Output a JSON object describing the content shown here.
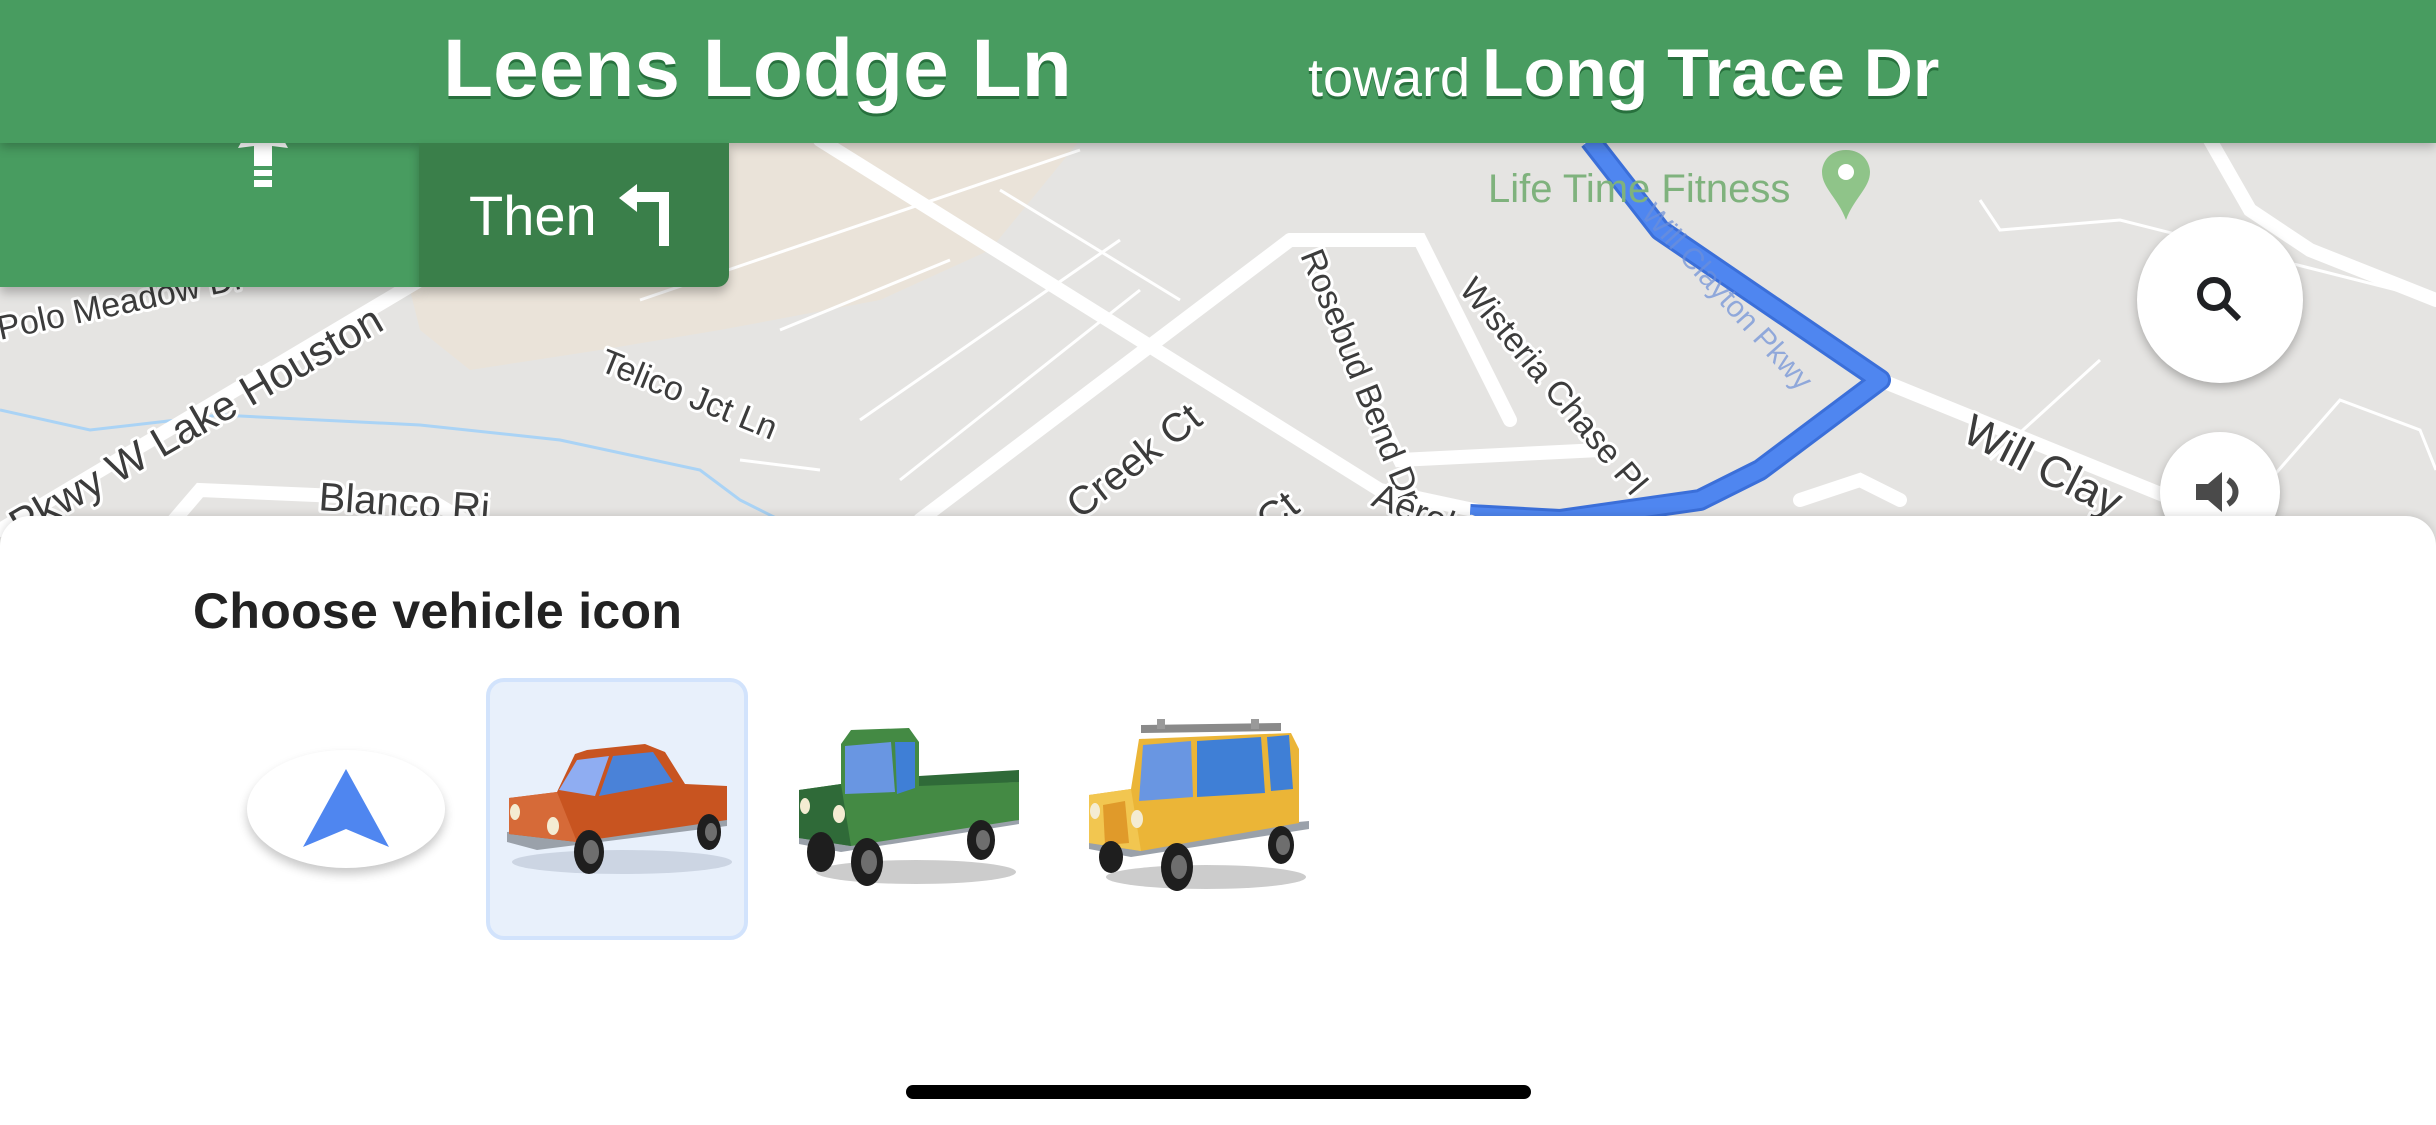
{
  "navigation": {
    "current_street": "Leens Lodge Ln",
    "toward_word": "toward",
    "toward_street": "Long Trace Dr",
    "then_label": "Then",
    "current_maneuver_icon": "straight-arrow-icon",
    "next_maneuver_icon": "turn-left-icon",
    "colors": {
      "header": "#489c60",
      "then_box": "#3a7f4a",
      "route": "#4f86f0"
    }
  },
  "map": {
    "poi": {
      "label": "Life Time Fitness",
      "icon": "map-pin-icon",
      "color": "#7fb27d"
    },
    "route_street_label": "Will Clayton Pkwy",
    "street_labels": [
      "Polo Meadow Dr",
      "Pkwy W Lake Houston",
      "Telico Jct Ln",
      "Blanco Ri",
      "Creek Ct",
      "Ct",
      "Rosebud Bend Dr",
      "Wisteria Chase Pl",
      "Aerobic Ave",
      "Will Clay"
    ],
    "buttons": {
      "search_icon": "search-icon",
      "sound_icon": "volume-icon"
    }
  },
  "sheet": {
    "title": "Choose vehicle icon",
    "options": [
      {
        "name": "Navigation arrow",
        "icon": "navigation-arrow-icon",
        "color": "#4f86f0",
        "selected": false
      },
      {
        "name": "Red sedan",
        "icon": "sedan-car-icon",
        "color": "#c9521f",
        "selected": true
      },
      {
        "name": "Green pickup truck",
        "icon": "pickup-truck-icon",
        "color": "#448a44",
        "selected": false
      },
      {
        "name": "Yellow SUV",
        "icon": "suv-icon",
        "color": "#ebb537",
        "selected": false
      }
    ],
    "selected_highlight": "#e8f0fb"
  }
}
